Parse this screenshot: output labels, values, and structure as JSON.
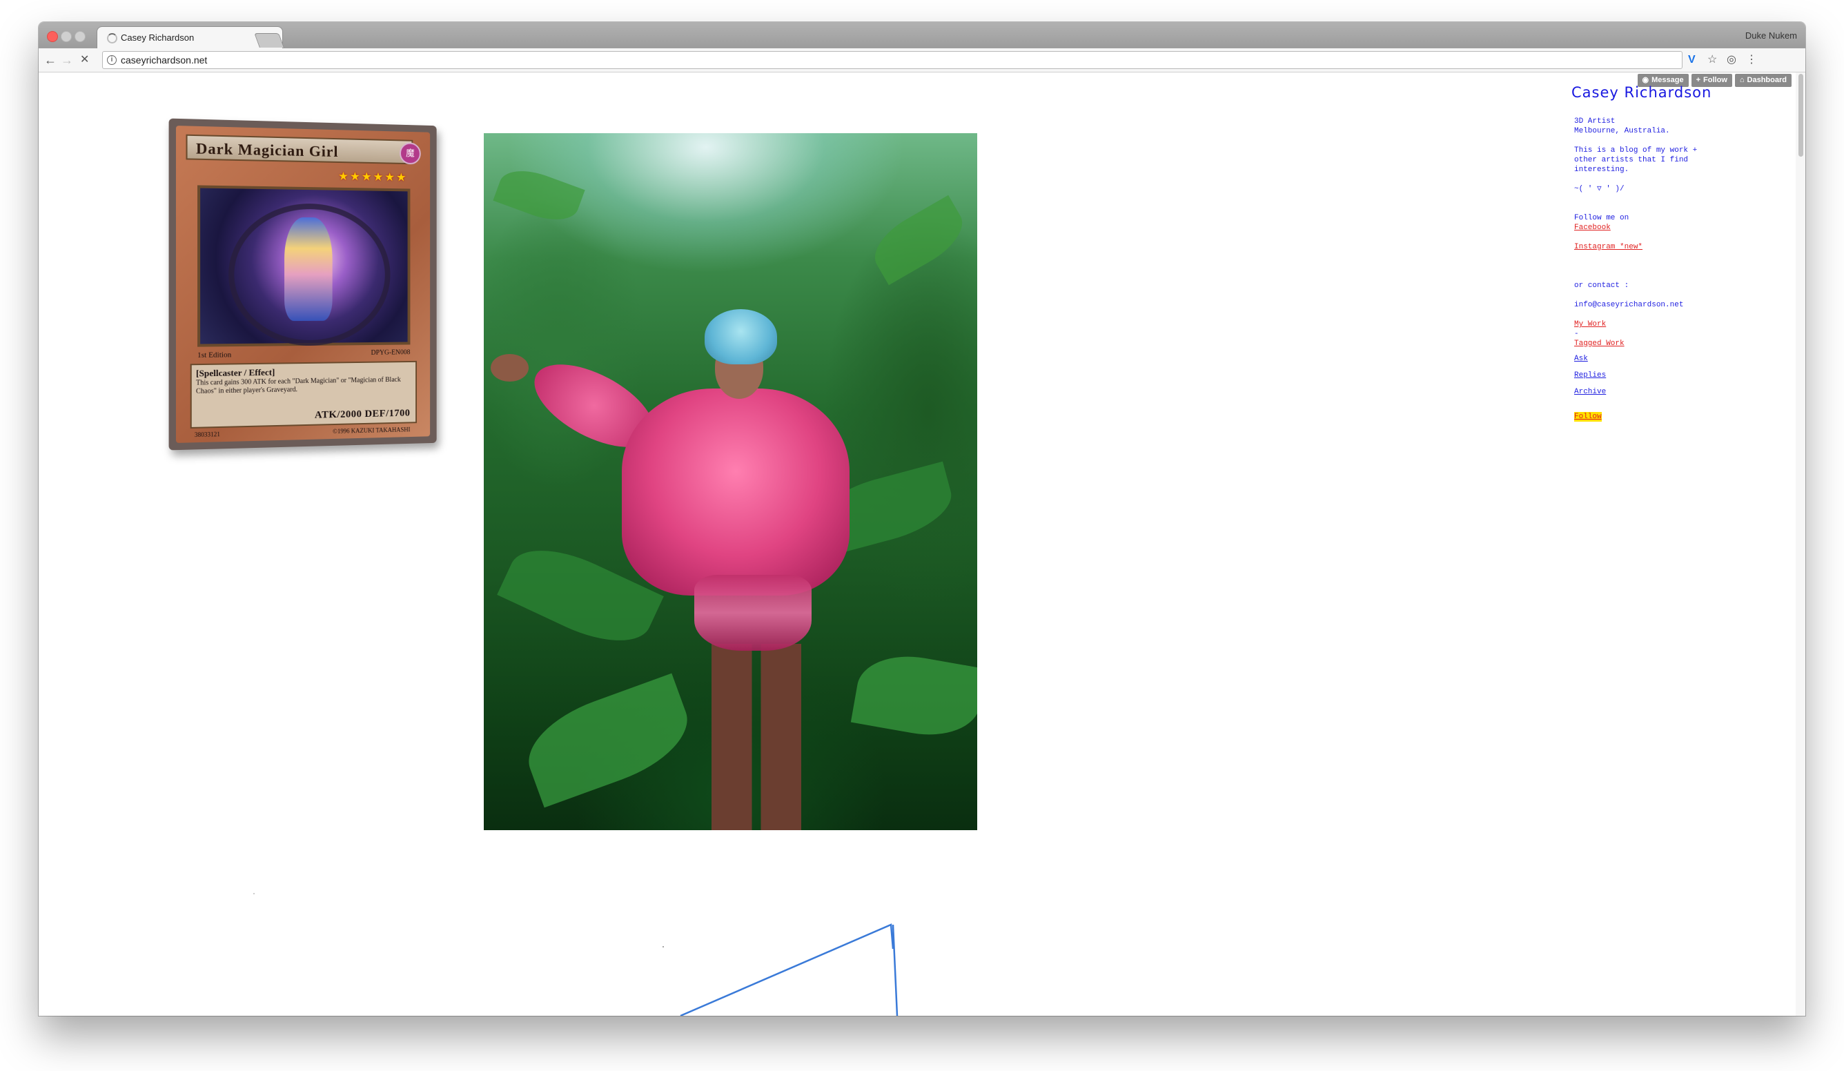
{
  "browser": {
    "tab_title": "Casey Richardson",
    "tab_close": "×",
    "profile_name": "Duke Nukem",
    "url": "caseyrichardson.net",
    "icons": [
      "back-arrow-icon",
      "forward-arrow-icon",
      "stop-icon",
      "info-icon",
      "vimeo-extension-icon",
      "bookmark-star-icon",
      "opera-extension-icon",
      "menu-icon"
    ]
  },
  "tumblr_controls": {
    "message_label": "Message",
    "follow_label": "Follow",
    "dashboard_label": "Dashboard"
  },
  "sidebar": {
    "title": "Casey Richardson",
    "bio": "3D Artist\nMelbourne, Australia.",
    "about": "This is a blog of my work +\nother artists that I find\ninteresting.",
    "kaomoji": "~( ' ▽ ' )/",
    "follow_intro": "Follow me on",
    "facebook_link": "Facebook",
    "instagram_link": "Instagram *new*",
    "contact_intro": "or contact :",
    "email": "info@caseyrichardson.net",
    "my_work_link": "My Work",
    "separator": "-",
    "tagged_work_link": "Tagged Work",
    "ask_link": "Ask",
    "replies_link": "Replies",
    "archive_link": "Archive",
    "follow_link": "Follow"
  },
  "card": {
    "name": "Dark Magician Girl",
    "attribute": "魔",
    "stars": "★★★★★★",
    "edition": "1st Edition",
    "set_code": "DPYG-EN008",
    "type_line": "[Spellcaster / Effect]",
    "effect_text": "This card gains 300 ATK for each \"Dark Magician\" or \"Magician of Black Chaos\" in either player's Graveyard.",
    "stats": "ATK/2000  DEF/1700",
    "serial": "38033121",
    "copyright": "©1996 KAZUKI TAKAHASHI"
  },
  "colors": {
    "sidebar_text": "#2020e0",
    "link_red": "#e02020",
    "follow_highlight": "#ffe000",
    "control_bg": "#8a8a8a"
  }
}
